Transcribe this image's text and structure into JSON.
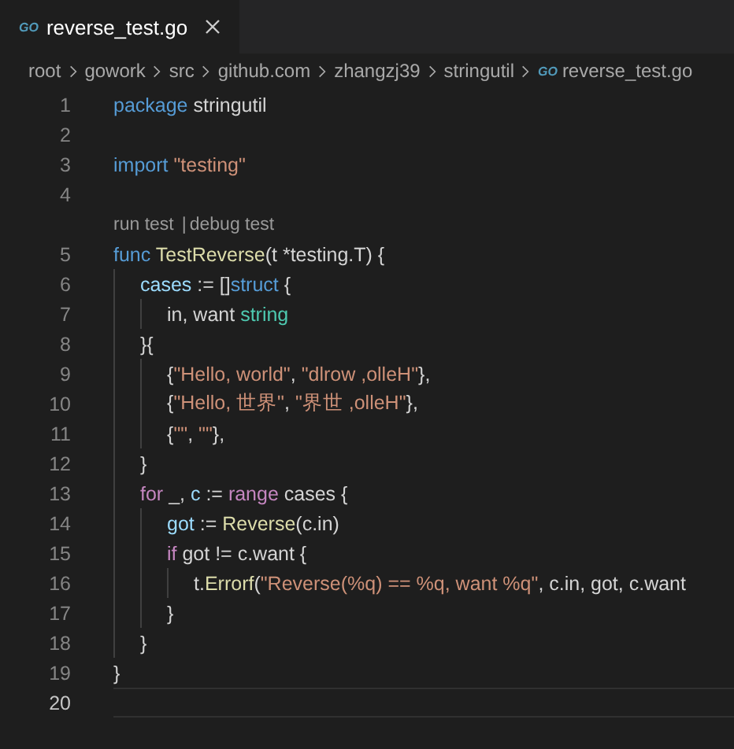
{
  "tabs": [
    {
      "file_icon": "GO",
      "label": "reverse_test.go",
      "selected": true
    }
  ],
  "breadcrumbs": [
    {
      "label": "root"
    },
    {
      "label": "gowork"
    },
    {
      "label": "src"
    },
    {
      "label": "github.com"
    },
    {
      "label": "zhangzj39"
    },
    {
      "label": "stringutil"
    },
    {
      "label": "reverse_test.go",
      "file_icon": "GO"
    }
  ],
  "editor": {
    "lines": [
      {
        "kind": "code",
        "number": "1",
        "current": false,
        "tokens": [
          {
            "text": "package",
            "kind": "keyword"
          },
          {
            "text": " stringutil",
            "kind": "plain"
          }
        ]
      },
      {
        "kind": "code",
        "number": "2",
        "current": false
      },
      {
        "kind": "code",
        "number": "3",
        "current": false,
        "tokens": [
          {
            "text": "import",
            "kind": "keyword"
          },
          {
            "text": " \"testing\"",
            "kind": "string"
          }
        ]
      },
      {
        "kind": "code",
        "number": "4",
        "current": false
      },
      {
        "kind": "codelens",
        "links": [
          "run test",
          "debug test"
        ],
        "separator": "|"
      },
      {
        "kind": "code",
        "number": "5",
        "current": false,
        "tokens": [
          {
            "text": "func",
            "kind": "keyword"
          },
          {
            "text": " TestReverse",
            "kind": "function"
          },
          {
            "text": "(t *testing.T) {",
            "kind": "plain"
          }
        ],
        "children": [
          {
            "kind": "code",
            "number": "6",
            "current": false,
            "tokens": [
              {
                "text": "cases",
                "kind": "variable"
              },
              {
                "text": " := []",
                "kind": "plain"
              },
              {
                "text": "struct",
                "kind": "keyword"
              },
              {
                "text": " {",
                "kind": "plain"
              }
            ],
            "children": [
              {
                "kind": "code",
                "number": "7",
                "current": false,
                "tokens": [
                  {
                    "text": "in, want ",
                    "kind": "plain"
                  },
                  {
                    "text": "string",
                    "kind": "type"
                  }
                ]
              }
            ]
          },
          {
            "kind": "code",
            "number": "8",
            "current": false,
            "tokens": [
              {
                "text": "}{",
                "kind": "plain"
              }
            ],
            "children": [
              {
                "kind": "code",
                "number": "9",
                "current": false,
                "tokens": [
                  {
                    "text": "{",
                    "kind": "plain"
                  },
                  {
                    "text": "\"Hello, world\"",
                    "kind": "string"
                  },
                  {
                    "text": ", ",
                    "kind": "plain"
                  },
                  {
                    "text": "\"dlrow ,olleH\"",
                    "kind": "string"
                  },
                  {
                    "text": "},",
                    "kind": "plain"
                  }
                ]
              },
              {
                "kind": "code",
                "number": "10",
                "current": false,
                "tokens": [
                  {
                    "text": "{",
                    "kind": "plain"
                  },
                  {
                    "text": "\"Hello, 世界\"",
                    "kind": "string"
                  },
                  {
                    "text": ", ",
                    "kind": "plain"
                  },
                  {
                    "text": "\"界世 ,olleH\"",
                    "kind": "string"
                  },
                  {
                    "text": "},",
                    "kind": "plain"
                  }
                ]
              },
              {
                "kind": "code",
                "number": "11",
                "current": false,
                "tokens": [
                  {
                    "text": "{",
                    "kind": "plain"
                  },
                  {
                    "text": "\"\"",
                    "kind": "string"
                  },
                  {
                    "text": ", ",
                    "kind": "plain"
                  },
                  {
                    "text": "\"\"",
                    "kind": "string"
                  },
                  {
                    "text": "},",
                    "kind": "plain"
                  }
                ]
              }
            ]
          },
          {
            "kind": "code",
            "number": "12",
            "current": false,
            "tokens": [
              {
                "text": "}",
                "kind": "plain"
              }
            ]
          },
          {
            "kind": "code",
            "number": "13",
            "current": false,
            "tokens": [
              {
                "text": "for",
                "kind": "control"
              },
              {
                "text": " _, ",
                "kind": "plain"
              },
              {
                "text": "c",
                "kind": "variable"
              },
              {
                "text": " := ",
                "kind": "plain"
              },
              {
                "text": "range",
                "kind": "control"
              },
              {
                "text": " cases {",
                "kind": "plain"
              }
            ],
            "children": [
              {
                "kind": "code",
                "number": "14",
                "current": false,
                "tokens": [
                  {
                    "text": "got",
                    "kind": "variable"
                  },
                  {
                    "text": " := ",
                    "kind": "plain"
                  },
                  {
                    "text": "Reverse",
                    "kind": "function"
                  },
                  {
                    "text": "(c.in)",
                    "kind": "plain"
                  }
                ]
              },
              {
                "kind": "code",
                "number": "15",
                "current": false,
                "tokens": [
                  {
                    "text": "if",
                    "kind": "control"
                  },
                  {
                    "text": " got != c.want {",
                    "kind": "plain"
                  }
                ],
                "children": [
                  {
                    "kind": "code",
                    "number": "16",
                    "current": false,
                    "tokens": [
                      {
                        "text": "t.",
                        "kind": "plain"
                      },
                      {
                        "text": "Errorf",
                        "kind": "function"
                      },
                      {
                        "text": "(",
                        "kind": "plain"
                      },
                      {
                        "text": "\"Reverse(%q) == %q, want %q\"",
                        "kind": "string"
                      },
                      {
                        "text": ", c.in, got, c.want",
                        "kind": "plain"
                      }
                    ]
                  }
                ]
              },
              {
                "kind": "code",
                "number": "17",
                "current": false,
                "tokens": [
                  {
                    "text": "}",
                    "kind": "plain"
                  }
                ]
              }
            ]
          },
          {
            "kind": "code",
            "number": "18",
            "current": false,
            "tokens": [
              {
                "text": "}",
                "kind": "plain"
              }
            ]
          }
        ]
      },
      {
        "kind": "code",
        "number": "19",
        "current": false,
        "tokens": [
          {
            "text": "}",
            "kind": "plain"
          }
        ]
      },
      {
        "kind": "code",
        "number": "20",
        "current": true
      }
    ]
  }
}
